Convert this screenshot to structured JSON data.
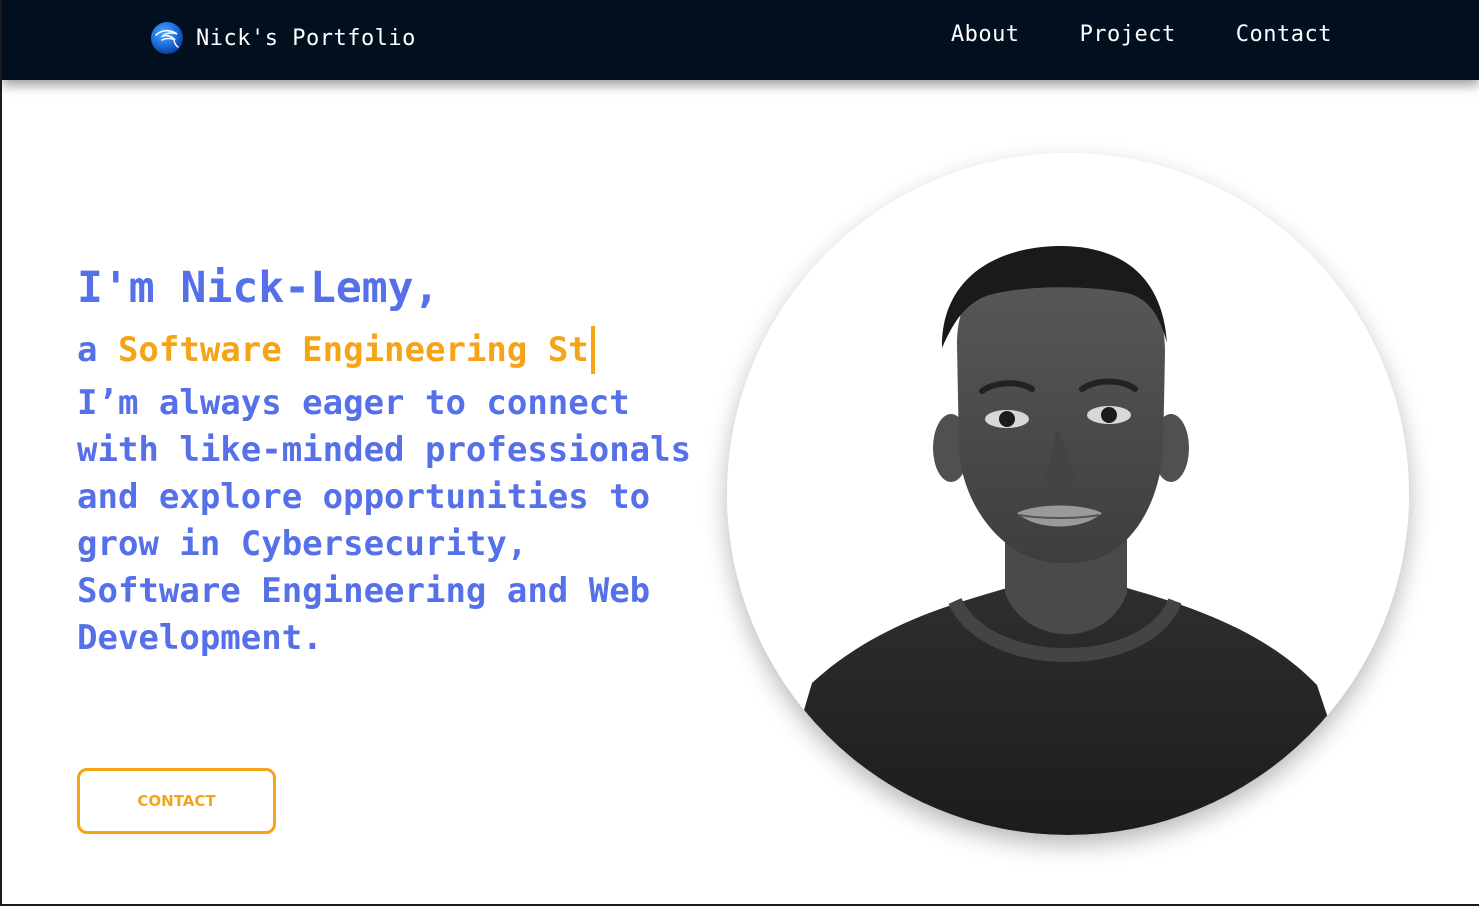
{
  "nav": {
    "brand": "Nick's Portfolio",
    "brand_logo_icon": "kali-dragon-logo-icon",
    "links": [
      {
        "label": "About"
      },
      {
        "label": "Project"
      },
      {
        "label": "Contact"
      }
    ]
  },
  "hero": {
    "greeting": "I'm Nick-Lemy,",
    "role_prefix": "a ",
    "role_typed": "Software Engineering St",
    "description": "I’m always eager to connect with like-minded professionals and explore opportunities to grow in Cybersecurity, Software Engineering and Web Development.",
    "cta_label": "CONTACT"
  },
  "profile_photo": {
    "icon": "portrait-photo",
    "style": "black-and-white"
  },
  "colors": {
    "navbar_bg": "#020f1f",
    "primary_blue": "#5570e8",
    "accent_orange": "#f5a418",
    "page_bg": "#ffffff"
  }
}
